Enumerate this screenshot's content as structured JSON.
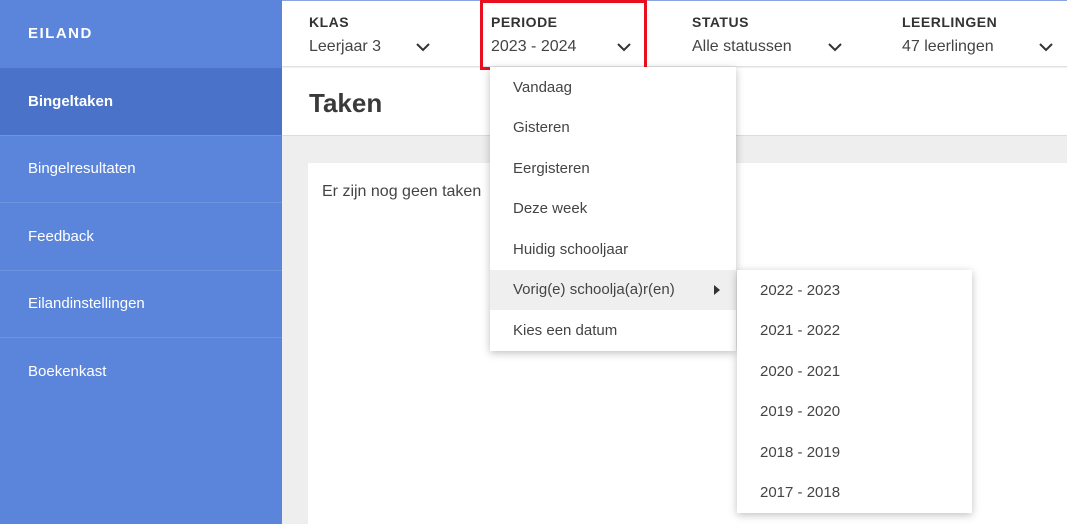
{
  "sidebar": {
    "brand": "EILAND",
    "items": [
      {
        "label": "Bingeltaken"
      },
      {
        "label": "Bingelresultaten"
      },
      {
        "label": "Feedback"
      },
      {
        "label": "Eilandinstellingen"
      },
      {
        "label": "Boekenkast"
      }
    ]
  },
  "filters": {
    "klas": {
      "label": "KLAS",
      "value": "Leerjaar 3"
    },
    "periode": {
      "label": "PERIODE",
      "value": "2023 - 2024"
    },
    "status": {
      "label": "STATUS",
      "value": "Alle statussen"
    },
    "leerlingen": {
      "label": "LEERLINGEN",
      "value": "47 leerlingen"
    }
  },
  "page": {
    "title": "Taken",
    "empty_text": "Er zijn nog geen taken"
  },
  "period_menu": {
    "items": [
      {
        "label": "Vandaag"
      },
      {
        "label": "Gisteren"
      },
      {
        "label": "Eergisteren"
      },
      {
        "label": "Deze week"
      },
      {
        "label": "Huidig schooljaar"
      },
      {
        "label": "Vorig(e) schoolja(a)r(en)"
      },
      {
        "label": "Kies een datum"
      }
    ]
  },
  "previous_years_menu": {
    "items": [
      {
        "label": "2022 - 2023"
      },
      {
        "label": "2021 - 2022"
      },
      {
        "label": "2020 - 2021"
      },
      {
        "label": "2019 - 2020"
      },
      {
        "label": "2018 - 2019"
      },
      {
        "label": "2017 - 2018"
      }
    ]
  },
  "colors": {
    "sidebar": "#5b85db",
    "sidebar_active": "#4a72c9",
    "highlight": "#e8101f"
  }
}
